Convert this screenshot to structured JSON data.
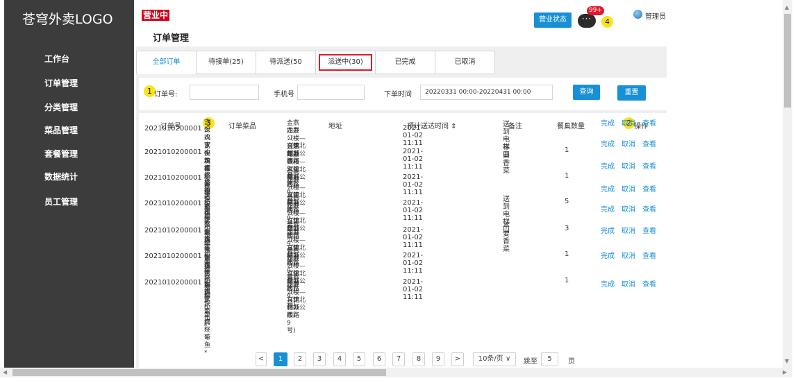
{
  "brand": {
    "logo": "苍穹外卖LOGO"
  },
  "sidebar": {
    "items": [
      "工作台",
      "订单管理",
      "分类管理",
      "菜品管理",
      "套餐管理",
      "数据统计",
      "员工管理"
    ]
  },
  "header": {
    "status_badge": "营业中",
    "title": "订单管理",
    "business_button": "营业状态",
    "message_icon_text": "···",
    "message_count": "99+",
    "user_name": "管理员"
  },
  "markers": [
    "1",
    "2",
    "3",
    "4"
  ],
  "tabs": [
    "全部订单",
    "待接单(25)",
    "待派送(50",
    "派送中(30)",
    "已完成",
    "已取消"
  ],
  "filter": {
    "order_label": "订单号:",
    "phone_label": "手机号",
    "time_label": "下单时间",
    "time_value": "20220331 00:00-20220431 00:00",
    "search_button": "查询",
    "reset_button": "重置"
  },
  "table": {
    "headers": [
      "订单号",
      "订单菜品",
      "地址",
      "预计送达时间 ⇕",
      "备注",
      "餐具数量",
      "操作"
    ],
    "rows": [
      {
        "id": "2021010200001",
        "dish1": "宫保鸡丁* 3; 红烧带鱼*",
        "dish2": "2; 农家小炒肉* 1;",
        "addr1": "金燕龙办公楼（建材城西路9号)",
        "addr2": "四层（——宾馆北侧办公楼)",
        "time": "2021-01-02 11:11",
        "note": "送到电梯口",
        "qty": "1"
      },
      {
        "id": "2021010200001",
        "dish1": "宫保鸡丁* 3; 红烧带色*",
        "dish2": "2; 农家小炒肉* 1;",
        "addr1": "金燕龙办公楼（建材城西路9号)",
        "addr2": "四层（——宾馆北侧办公楼)",
        "time": "2021-01-02 11:11",
        "note": "不要香菜",
        "qty": "1"
      },
      {
        "id": "2021010200001",
        "dish1": "宫保鸡丁* 3; 红烧带鱼*",
        "dish2": "2; 农家小炒肉* 1;",
        "addr1": "金燕龙办公楼（建材城西路9号)",
        "addr2": "四层（——宾馆北侧办公楼)",
        "time": "2021-01-02 11:11",
        "note": "",
        "qty": "1"
      },
      {
        "id": "2021010200001",
        "dish1": "宫保鸡丁* 3; 红烧带鱼*",
        "dish2": "2; 农家小炒肉* 1;",
        "addr1": "金燕龙办公楼（建材城西路9号)",
        "addr2": "四层（——宾馆北侧办公楼)",
        "time": "2021-01-02 11:11",
        "note": "送到电梯口",
        "qty": "5"
      },
      {
        "id": "2021010200001",
        "dish1": "宫保鸡丁* 3; 红烧带色*",
        "dish2": "2; 农家小炒肉* 1;",
        "addr1": "金燕龙办公楼（建材城西路9号)",
        "addr2": "四层（——宾馆北侧办公楼)",
        "time": "2021-01-02 11:11",
        "note": "不要香菜",
        "qty": "3"
      },
      {
        "id": "2021010200001",
        "dish1": "宫保鸡丁* 3; 红烧带鱼*",
        "dish2": "2; 农家小炒肉* 1;",
        "addr1": "金燕龙办公楼（建材城西路9号)",
        "addr2": "四层（——宾馆北侧办公楼)",
        "time": "2021-01-02 11:11",
        "note": "",
        "qty": "1"
      },
      {
        "id": "2021010200001",
        "dish1": "宫保鸡丁* 3; 红烧带鱼*",
        "dish2": "2; 农家小炒肉* 1;",
        "addr1": "金燕龙办公楼（建材城西路9号)",
        "addr2": "四层（——宾馆北侧办公楼)",
        "time": "2021-01-02 11:11",
        "note": "",
        "qty": "1"
      }
    ],
    "actions": [
      "完成",
      "取消",
      "查看"
    ]
  },
  "pagination": {
    "prev": "<",
    "pages": [
      "1",
      "2",
      "3",
      "4",
      "5",
      "6",
      "7",
      "8",
      "9"
    ],
    "next": ">",
    "page_size": "10条/页 ∨",
    "jump_label": "跳至",
    "jump_value": "5",
    "page_unit": "页"
  },
  "colors": {
    "accent": "#1890d6",
    "sidebar": "#3c3c3c",
    "alert": "#e0182d",
    "marker": "#fbe31c"
  }
}
